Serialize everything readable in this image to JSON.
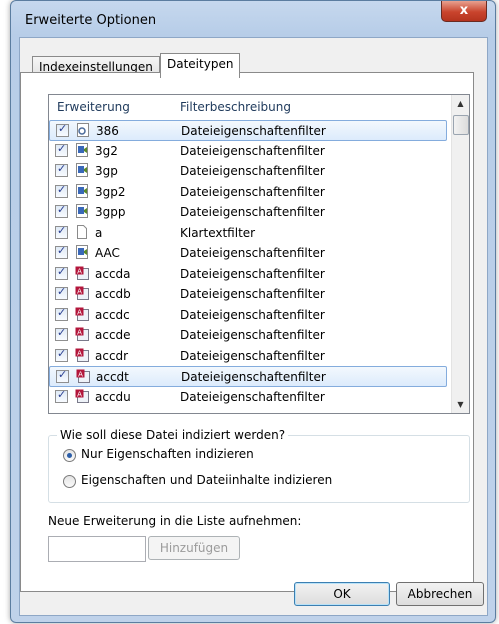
{
  "window": {
    "title": "Erweiterte Optionen",
    "close_glyph": "x"
  },
  "tabs": [
    {
      "label": "Indexeinstellungen",
      "active": false
    },
    {
      "label": "Dateitypen",
      "active": true
    }
  ],
  "list": {
    "columns": [
      "Erweiterung",
      "Filterbeschreibung"
    ],
    "rows": [
      {
        "ext": "386",
        "desc": "Dateieigenschaftenfilter",
        "icon": "gear-file-icon",
        "selected": true
      },
      {
        "ext": "3g2",
        "desc": "Dateieigenschaftenfilter",
        "icon": "media-file-icon",
        "selected": false
      },
      {
        "ext": "3gp",
        "desc": "Dateieigenschaftenfilter",
        "icon": "media-file-icon",
        "selected": false
      },
      {
        "ext": "3gp2",
        "desc": "Dateieigenschaftenfilter",
        "icon": "media-file-icon",
        "selected": false
      },
      {
        "ext": "3gpp",
        "desc": "Dateieigenschaftenfilter",
        "icon": "media-file-icon",
        "selected": false
      },
      {
        "ext": "a",
        "desc": "Klartextfilter",
        "icon": "blank-file-icon",
        "selected": false
      },
      {
        "ext": "AAC",
        "desc": "Dateieigenschaftenfilter",
        "icon": "media-file-icon",
        "selected": false
      },
      {
        "ext": "accda",
        "desc": "Dateieigenschaftenfilter",
        "icon": "access-file-icon",
        "selected": false
      },
      {
        "ext": "accdb",
        "desc": "Dateieigenschaftenfilter",
        "icon": "access-file-icon",
        "selected": false
      },
      {
        "ext": "accdc",
        "desc": "Dateieigenschaftenfilter",
        "icon": "access-file-icon",
        "selected": false
      },
      {
        "ext": "accde",
        "desc": "Dateieigenschaftenfilter",
        "icon": "access-file-icon",
        "selected": false
      },
      {
        "ext": "accdr",
        "desc": "Dateieigenschaftenfilter",
        "icon": "access-file-icon",
        "selected": false
      },
      {
        "ext": "accdt",
        "desc": "Dateieigenschaftenfilter",
        "icon": "access-file-icon",
        "selected": true
      },
      {
        "ext": "accdu",
        "desc": "Dateieigenschaftenfilter",
        "icon": "access-file-icon",
        "selected": false
      }
    ]
  },
  "index_group": {
    "title": "Wie soll diese Datei indiziert werden?",
    "options": [
      {
        "label": "Nur Eigenschaften indizieren",
        "checked": true
      },
      {
        "label": "Eigenschaften und Dateiinhalte indizieren",
        "checked": false
      }
    ]
  },
  "add_extension": {
    "label": "Neue Erweiterung in die Liste aufnehmen:",
    "value": "",
    "button": "Hinzufügen"
  },
  "footer": {
    "ok": "OK",
    "cancel": "Abbrechen"
  },
  "colors": {
    "selection_border": "#84acdd",
    "close_button": "#c9442d",
    "title_bar": "#c6d8ee"
  }
}
